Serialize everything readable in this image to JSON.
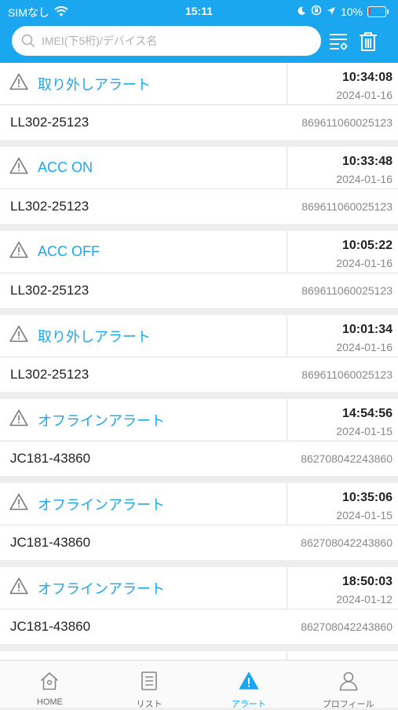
{
  "status_bar": {
    "carrier": "SIMなし",
    "time": "15:11",
    "battery": "10%"
  },
  "search": {
    "placeholder": "IMEI(下5桁)/デバイス名"
  },
  "alerts": [
    {
      "title": "取り外しアラート",
      "time": "10:34:08",
      "date": "2024-01-16",
      "device": "LL302-25123",
      "imei": "869611060025123"
    },
    {
      "title": "ACC ON",
      "time": "10:33:48",
      "date": "2024-01-16",
      "device": "LL302-25123",
      "imei": "869611060025123"
    },
    {
      "title": "ACC OFF",
      "time": "10:05:22",
      "date": "2024-01-16",
      "device": "LL302-25123",
      "imei": "869611060025123"
    },
    {
      "title": "取り外しアラート",
      "time": "10:01:34",
      "date": "2024-01-16",
      "device": "LL302-25123",
      "imei": "869611060025123"
    },
    {
      "title": "オフラインアラート",
      "time": "14:54:56",
      "date": "2024-01-15",
      "device": "JC181-43860",
      "imei": "862708042243860"
    },
    {
      "title": "オフラインアラート",
      "time": "10:35:06",
      "date": "2024-01-15",
      "device": "JC181-43860",
      "imei": "862708042243860"
    },
    {
      "title": "オフラインアラート",
      "time": "18:50:03",
      "date": "2024-01-12",
      "device": "JC181-43860",
      "imei": "862708042243860"
    }
  ],
  "nav": {
    "items": [
      {
        "label": "HOME",
        "icon": "home-icon"
      },
      {
        "label": "リスト",
        "icon": "list-icon"
      },
      {
        "label": "アラート",
        "icon": "alert-icon"
      },
      {
        "label": "プロフィール",
        "icon": "profile-icon"
      }
    ],
    "active_index": 2
  },
  "colors": {
    "accent": "#1aa7f0",
    "battery_low": "#ff3b30"
  }
}
